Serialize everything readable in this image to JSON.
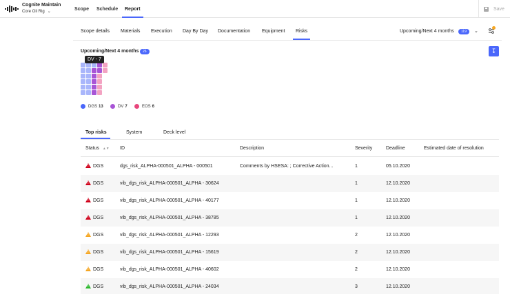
{
  "app": {
    "title": "Cognite Maintain",
    "site": "Core Oil Rig"
  },
  "topnav": {
    "scope": "Scope",
    "schedule": "Schedule",
    "report": "Report",
    "save": "Save"
  },
  "subtabs": [
    "Scope details",
    "Materials",
    "Execution",
    "Day By Day",
    "Documentation",
    "Equipment",
    "Risks"
  ],
  "period_selector": {
    "label": "Upcoming/Next 4 months",
    "count": "119"
  },
  "section": {
    "title": "Upcoming/Next 4 months",
    "count": "26"
  },
  "tooltip": "DV - 7",
  "legend": [
    {
      "name": "DGS",
      "value": "13",
      "color": "#4a67fb"
    },
    {
      "name": "DV",
      "value": "7",
      "color": "#a855d6"
    },
    {
      "name": "EOS",
      "value": "6",
      "color": "#e8467c"
    }
  ],
  "risk_tabs": [
    "Top risks",
    "System",
    "Deck level"
  ],
  "table": {
    "columns": [
      "Status",
      "ID",
      "Description",
      "Severity",
      "Deadline",
      "Estimated date of resolution"
    ],
    "rows": [
      {
        "status": "DGS",
        "level": "high",
        "id": "dgs_risk_ALPHA-000501_ALPHA - 000501",
        "description": "Comments by HSESA: ; Corrective Action...",
        "severity": "1",
        "deadline": "05.10.2020",
        "resolution": ""
      },
      {
        "status": "DGS",
        "level": "high",
        "id": "vib_dgs_risk_ALPHA-000501_ALPHA - 30624",
        "description": "",
        "severity": "1",
        "deadline": "12.10.2020",
        "resolution": ""
      },
      {
        "status": "DGS",
        "level": "high",
        "id": "vib_dgs_risk_ALPHA-000501_ALPHA - 40177",
        "description": "",
        "severity": "1",
        "deadline": "12.10.2020",
        "resolution": ""
      },
      {
        "status": "DGS",
        "level": "high",
        "id": "vib_dgs_risk_ALPHA-000501_ALPHA - 38785",
        "description": "",
        "severity": "1",
        "deadline": "12.10.2020",
        "resolution": ""
      },
      {
        "status": "DGS",
        "level": "medium",
        "id": "vib_dgs_risk_ALPHA-000501_ALPHA - 12293",
        "description": "",
        "severity": "2",
        "deadline": "12.10.2020",
        "resolution": ""
      },
      {
        "status": "DGS",
        "level": "medium",
        "id": "vib_dgs_risk_ALPHA-000501_ALPHA - 15619",
        "description": "",
        "severity": "2",
        "deadline": "12.10.2020",
        "resolution": ""
      },
      {
        "status": "DGS",
        "level": "medium",
        "id": "vib_dgs_risk_ALPHA-000501_ALPHA - 40602",
        "description": "",
        "severity": "2",
        "deadline": "12.10.2020",
        "resolution": ""
      },
      {
        "status": "DGS",
        "level": "low",
        "id": "vib_dgs_risk_ALPHA-000501_ALPHA - 24034",
        "description": "",
        "severity": "3",
        "deadline": "12.10.2020",
        "resolution": ""
      }
    ]
  },
  "colors": {
    "accent": "#4a67fb",
    "dgs_light": "#a9b6fb",
    "dv": "#a855d6",
    "eos_light": "#f3a3c2",
    "status_high": "#d0021b",
    "status_medium": "#f5a623",
    "status_low": "#2eb82e"
  },
  "icons": {
    "logo": "cognite-logo-icon",
    "save": "save-icon",
    "filter": "filter-settings-icon",
    "download": "download-icon",
    "sort": "sort-icon",
    "warning": "warning-triangle-icon"
  }
}
